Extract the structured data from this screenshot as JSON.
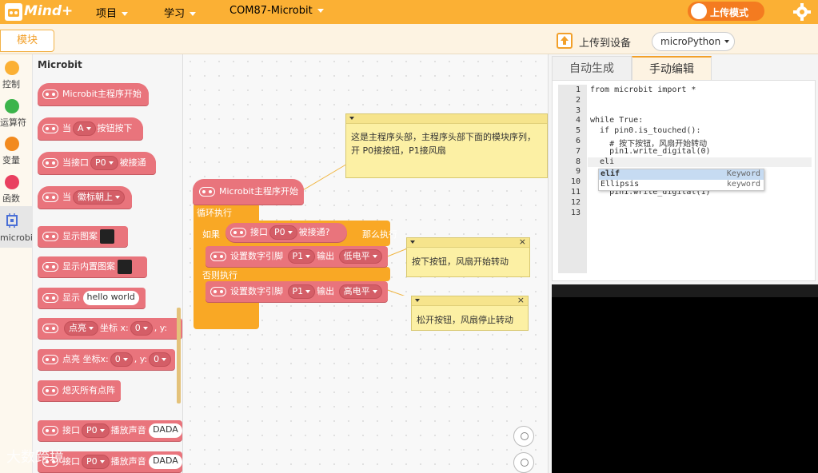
{
  "app": {
    "logo_text": "Mind+"
  },
  "menu": {
    "project": "项目",
    "learn": "学习",
    "port": "COM87-Microbit"
  },
  "topbar": {
    "upload_mode": "上传模式"
  },
  "subbar": {
    "blocks_tab": "模块",
    "upload_label": "上传到设备",
    "language_select": "microPython"
  },
  "categories": [
    {
      "label": "控制",
      "color": "#fbb034"
    },
    {
      "label": "运算符",
      "color": "#3cb44b"
    },
    {
      "label": "变量",
      "color": "#f28a1e"
    },
    {
      "label": "函数",
      "color": "#e94060"
    },
    {
      "label": "microbit",
      "color": "#4a6fd6"
    }
  ],
  "palette": {
    "title": "Microbit",
    "main_start": "Microbit主程序开始",
    "when": "当",
    "button_a": "A",
    "button_pressed": "按钮按下",
    "when_pin": "当接口",
    "pin_p0": "P0",
    "pin_touched": "被接通",
    "logo_up": "徽标朝上",
    "show_image": "显示图案",
    "show_builtin": "显示内置图案",
    "show": "显示",
    "hello": "hello world",
    "light": "点亮",
    "coord_x": "坐标 x:",
    "zero": "0",
    "y_label": ", y:",
    "light2": "点亮 坐标x:",
    "clear_all": "熄灭所有点阵",
    "pin_label": "接口",
    "play_sound": "播放声音",
    "dada": "DADA"
  },
  "workspace": {
    "main_block": "Microbit主程序开始",
    "loop": "循环执行",
    "if_label": "如果",
    "pin": "接口",
    "p0": "P0",
    "touched": "被接通?",
    "then": "那么执行",
    "set_pin": "设置数字引脚",
    "p1": "P1",
    "output": "输出",
    "low": "低电平",
    "else": "否则执行",
    "high": "高电平",
    "note1": "这是主程序头部，主程序头部下面的模块序列，开 P0接按钮，P1接风扇",
    "note2": "按下按钮，风扇开始转动",
    "note3": "松开按钮，风扇停止转动",
    "note_close": "×"
  },
  "tabs": {
    "auto": "自动生成",
    "manual": "手动编辑"
  },
  "editor": {
    "line_numbers": [
      "1",
      "2",
      "3",
      "4",
      "5",
      "6",
      "7",
      "8",
      "9",
      "10",
      "11",
      "12",
      "13"
    ],
    "lines": [
      "from microbit import *",
      "",
      "",
      "while True:",
      "  if pin0.is_touched():",
      "    # 按下按钮，风扇开始转动",
      "    pin1.write_digital(0)",
      "  eli",
      "",
      "",
      "    pin1.write_digital(1)",
      "",
      ""
    ],
    "autocomplete": [
      {
        "text": "elif",
        "kind": "Keyword"
      },
      {
        "text": "Ellipsis",
        "kind": "keyword"
      }
    ]
  },
  "watermark": "大数跨境"
}
